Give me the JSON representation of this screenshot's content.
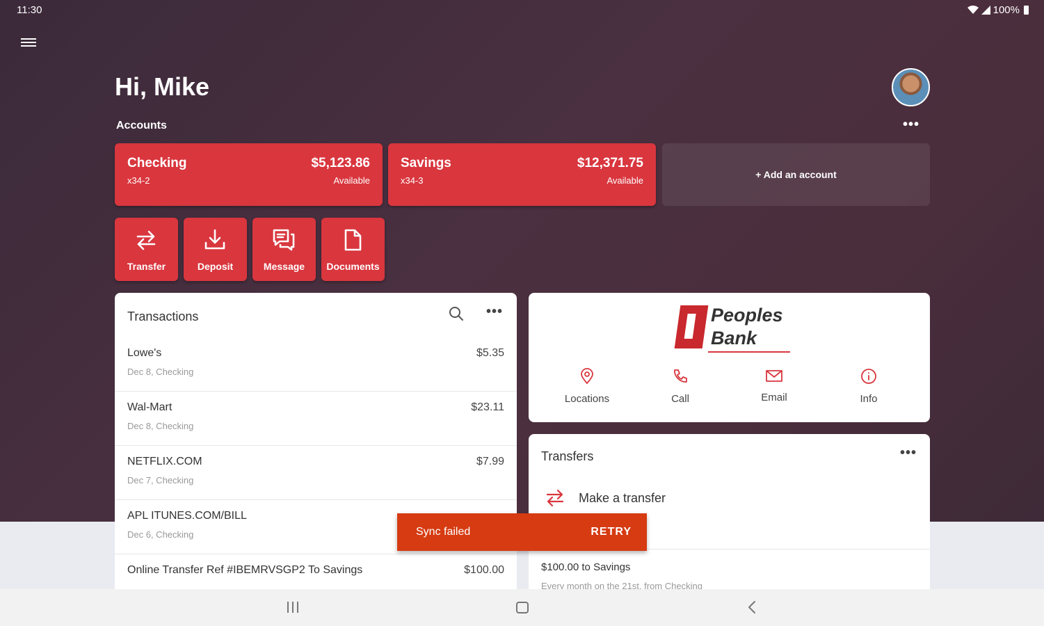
{
  "status": {
    "time": "11:30",
    "battery": "100%"
  },
  "header": {
    "greeting": "Hi, Mike",
    "accounts_label": "Accounts",
    "more": "•••"
  },
  "accounts": [
    {
      "name": "Checking",
      "number": "x34-2",
      "balance": "$5,123.86",
      "balance_label": "Available"
    },
    {
      "name": "Savings",
      "number": "x34-3",
      "balance": "$12,371.75",
      "balance_label": "Available"
    }
  ],
  "add_account": "+ Add an account",
  "actions": [
    {
      "label": "Transfer",
      "icon": "transfer-icon"
    },
    {
      "label": "Deposit",
      "icon": "download-icon"
    },
    {
      "label": "Message",
      "icon": "chat-icon"
    },
    {
      "label": "Documents",
      "icon": "document-icon"
    }
  ],
  "transactions": {
    "title": "Transactions",
    "more": "•••",
    "items": [
      {
        "name": "Lowe's",
        "sub": "Dec 8, Checking",
        "amount": "$5.35"
      },
      {
        "name": "Wal-Mart",
        "sub": "Dec 8, Checking",
        "amount": "$23.11"
      },
      {
        "name": "NETFLIX.COM",
        "sub": "Dec 7, Checking",
        "amount": "$7.99"
      },
      {
        "name": "APL ITUNES.COM/BILL",
        "sub": "Dec 6, Checking",
        "amount": ""
      },
      {
        "name": "Online Transfer Ref #IBEMRVSGP2 To Savings",
        "sub": "",
        "amount": "$100.00"
      }
    ]
  },
  "bank": {
    "logo_line1": "Peoples",
    "logo_line2": "Bank",
    "contacts": [
      {
        "label": "Locations",
        "icon": "location-pin-icon"
      },
      {
        "label": "Call",
        "icon": "phone-icon"
      },
      {
        "label": "Email",
        "icon": "mail-icon"
      },
      {
        "label": "Info",
        "icon": "info-icon"
      }
    ]
  },
  "transfers": {
    "title": "Transfers",
    "more": "•••",
    "make_transfer": "Make a transfer",
    "scheduled_title": "$100.00 to Savings",
    "scheduled_sub": "Every month on the 21st, from Checking"
  },
  "snackbar": {
    "message": "Sync failed",
    "action": "RETRY"
  },
  "colors": {
    "brand_red": "#d9363e",
    "snackbar": "#d63b12",
    "background_dark": "#4a3040"
  }
}
